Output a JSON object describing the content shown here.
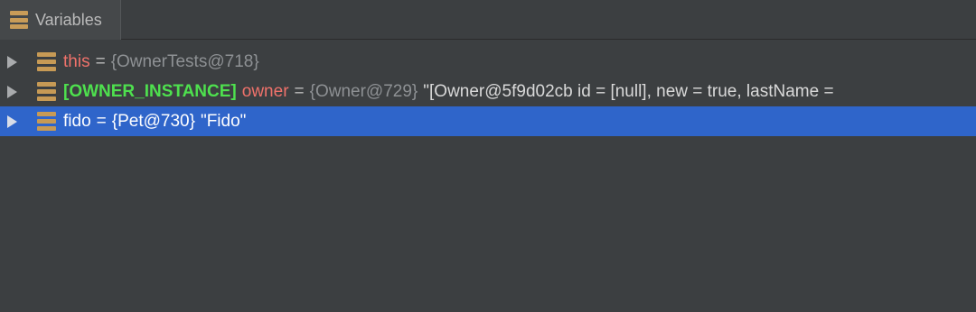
{
  "panel": {
    "tab_label": "Variables",
    "tab_icon": "variables-stack-icon"
  },
  "rows": [
    {
      "watch": "",
      "name": "this",
      "equals": "=",
      "ref": "{OwnerTests@718}",
      "value": ""
    },
    {
      "watch": "[OWNER_INSTANCE]",
      "name": "owner",
      "equals": "=",
      "ref": "{Owner@729}",
      "value": "\"[Owner@5f9d02cb id = [null], new = true, lastName = "
    },
    {
      "watch": "",
      "name": "fido",
      "equals": "=",
      "ref": "{Pet@730}",
      "value": "\"Fido\""
    }
  ],
  "selected_row": "fido",
  "colors": {
    "background": "#3c3f41",
    "selection": "#2f65ca",
    "variable_name": "#f0726b",
    "watch_label": "#4ee04e",
    "reference": "#8e9194",
    "icon": "#c79a55"
  }
}
